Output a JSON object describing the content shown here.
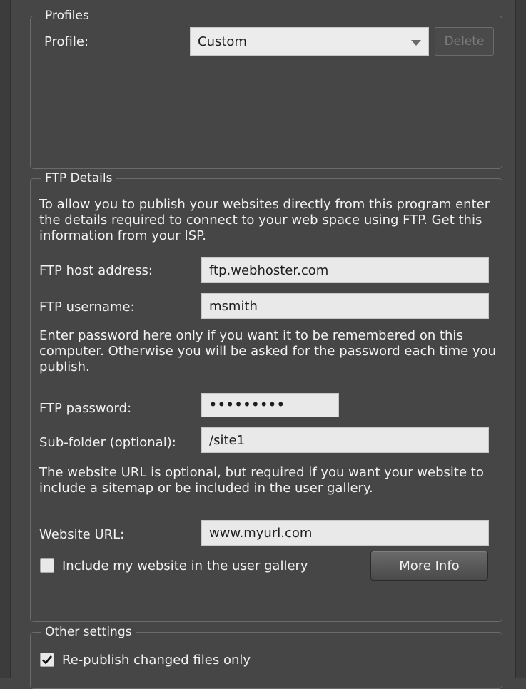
{
  "profiles": {
    "legend": "Profiles",
    "profile_label": "Profile:",
    "profile_value": "Custom",
    "delete_label": "Delete"
  },
  "ftp": {
    "legend": "FTP Details",
    "intro": "To allow you to publish your websites directly from this program enter the details required to connect to your web space using FTP.  Get this information from your ISP.",
    "host_label": "FTP host address:",
    "host_value": "ftp.webhoster.com",
    "username_label": "FTP username:",
    "username_value": "msmith",
    "password_note": "Enter password here only if you want it to be remembered on this computer. Otherwise you will be asked for the password each time you publish.",
    "password_label": "FTP password:",
    "password_value": "•••••••••",
    "subfolder_label": "Sub-folder (optional):",
    "subfolder_value": "/site1",
    "url_note": "The website URL is optional, but required if you want your website to include a sitemap or be included in the user gallery.",
    "url_label": "Website URL:",
    "url_value": "www.myurl.com",
    "gallery_label": "Include my website in the user gallery",
    "gallery_checked": false,
    "more_info_label": "More Info"
  },
  "other": {
    "legend": "Other settings",
    "republish_label": "Re-publish changed files only",
    "republish_checked": true
  }
}
